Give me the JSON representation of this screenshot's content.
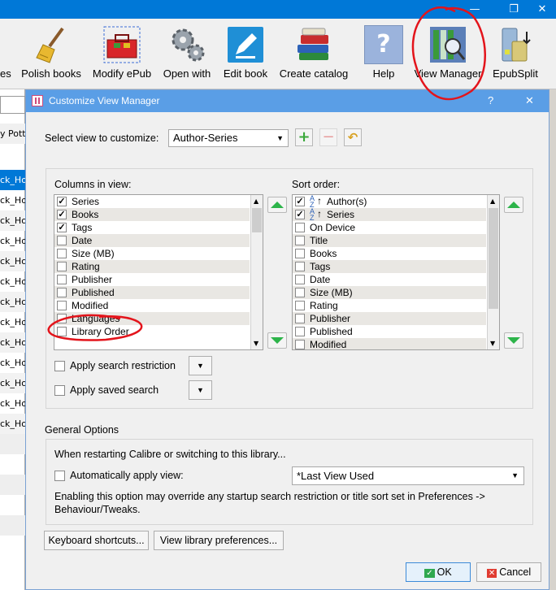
{
  "titlebar": {
    "minimize": "—",
    "restore": "❐",
    "close": "✕"
  },
  "toolbar": {
    "items": [
      {
        "label": "es"
      },
      {
        "label": "Polish books"
      },
      {
        "label": "Modify ePub"
      },
      {
        "label": "Open with"
      },
      {
        "label": "Edit book"
      },
      {
        "label": "Create catalog"
      },
      {
        "label": "Help"
      },
      {
        "label": "View Manager"
      },
      {
        "label": "EpubSplit"
      }
    ]
  },
  "library_strip": {
    "header": "y Pott",
    "rows": [
      "ck_Ho",
      "ck_Ho",
      "ck_Ho",
      "ck_Ho",
      "ck_Ho",
      "ck_Ho",
      "ck_Ho",
      "ck_Ho",
      "ck_Ho",
      "ck_Ho",
      "ck_Ho",
      "ck_Ho",
      "ck_Ho"
    ]
  },
  "dialog": {
    "title": "Customize View Manager",
    "help_button": "?",
    "close_button": "✕",
    "select_view_label": "Select view to customize:",
    "selected_view": "Author-Series",
    "columns_label": "Columns in view:",
    "columns": [
      {
        "label": "Series",
        "checked": true
      },
      {
        "label": "Books",
        "checked": true
      },
      {
        "label": "Tags",
        "checked": true
      },
      {
        "label": "Date",
        "checked": false
      },
      {
        "label": "Size (MB)",
        "checked": false
      },
      {
        "label": "Rating",
        "checked": false
      },
      {
        "label": "Publisher",
        "checked": false
      },
      {
        "label": "Published",
        "checked": false
      },
      {
        "label": "Modified",
        "checked": false
      },
      {
        "label": "Languages",
        "checked": false
      },
      {
        "label": "Library Order",
        "checked": false
      }
    ],
    "sort_label": "Sort order:",
    "sort": [
      {
        "label": "Author(s)",
        "checked": true,
        "icon": "sort-ascending-icon"
      },
      {
        "label": "Series",
        "checked": true,
        "icon": "sort-ascending-icon"
      },
      {
        "label": "On Device",
        "checked": false
      },
      {
        "label": "Title",
        "checked": false
      },
      {
        "label": "Books",
        "checked": false
      },
      {
        "label": "Tags",
        "checked": false
      },
      {
        "label": "Date",
        "checked": false
      },
      {
        "label": "Size (MB)",
        "checked": false
      },
      {
        "label": "Rating",
        "checked": false
      },
      {
        "label": "Publisher",
        "checked": false
      },
      {
        "label": "Published",
        "checked": false
      },
      {
        "label": "Modified",
        "checked": false
      }
    ],
    "apply_search_restriction_label": "Apply search restriction",
    "apply_saved_search_label": "Apply saved search",
    "general_options_label": "General Options",
    "restart_text": "When restarting Calibre or switching to this library...",
    "auto_apply_label": "Automatically apply view:",
    "auto_apply_value": "*Last View Used",
    "note_text_1": "Enabling this option may override any startup search restriction or title sort set in Preferences ->",
    "note_text_2": "Behaviour/Tweaks.",
    "keyboard_shortcuts_button": "Keyboard shortcuts...",
    "view_library_preferences_button": "View library preferences...",
    "ok_button": "OK",
    "cancel_button": "Cancel"
  },
  "colors": {
    "titlebar": "#0078d7",
    "dialog_title": "#5a9ee6",
    "annotation": "#e3141b",
    "add_green": "#3aa83a"
  }
}
